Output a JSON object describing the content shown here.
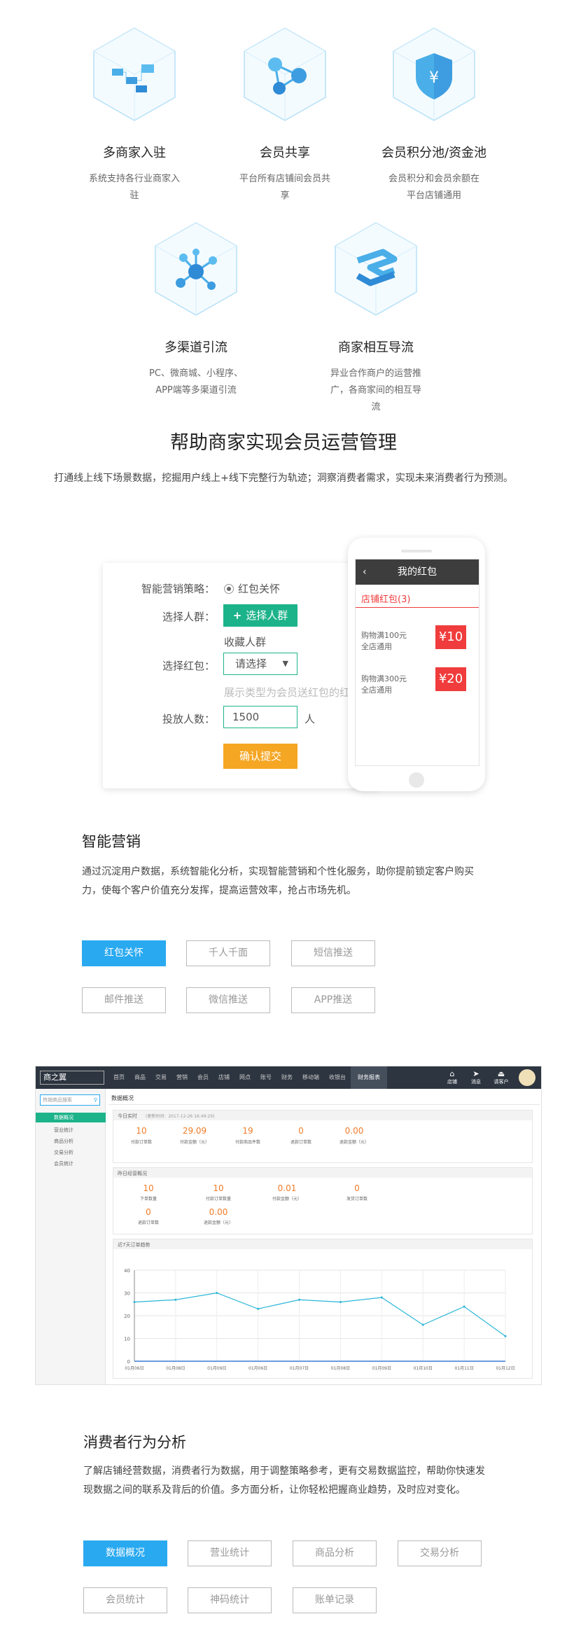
{
  "features": [
    {
      "title": "多商家入驻",
      "desc": "系统支持各行业商家入驻",
      "icon": "building-blocks-icon"
    },
    {
      "title": "会员共享",
      "desc": "平台所有店铺间会员共享",
      "icon": "network-nodes-icon"
    },
    {
      "title": "会员积分池/资金池",
      "desc": "会员积分和会员余额在平台店铺通用",
      "icon": "yuan-shield-icon"
    },
    {
      "title": "多渠道引流",
      "desc": "PC、微商城、小程序、APP端等多渠道引流",
      "icon": "hub-nodes-icon"
    },
    {
      "title": "商家相互导流",
      "desc": "异业合作商户的运营推广，各商家间的相互导流",
      "icon": "flow-arrows-icon"
    }
  ],
  "section": {
    "title": "帮助商家实现会员运营管理",
    "subtitle": "打通线上线下场景数据，挖掘用户线上+线下完整行为轨迹；洞察消费者需求，实现未来消费者行为预测。"
  },
  "form": {
    "strategy_label": "智能营销策略：",
    "strategy_value": "红包关怀",
    "crowd_label": "选择人群：",
    "crowd_button": "选择人群",
    "crowd_value": "收藏人群",
    "packet_label": "选择红包：",
    "packet_placeholder": "请选择",
    "packet_hint": "展示类型为会员送红包的红包",
    "count_label": "投放人数：",
    "count_value": "1500",
    "count_unit": "人",
    "submit": "确认提交"
  },
  "phone": {
    "title": "我的红包",
    "shop_packet": "店铺红包(3)",
    "coupons": [
      {
        "cond": "购物满100元",
        "scope": "全店通用",
        "amount": "¥10"
      },
      {
        "cond": "购物满300元",
        "scope": "全店通用",
        "amount": "¥20"
      }
    ]
  },
  "marketing": {
    "title": "智能营销",
    "desc": "通过沉淀用户数据，系统智能化分析，实现智能营销和个性化服务，助你提前锁定客户购买力，使每个客户价值充分发挥，提高运营效率，抢占市场先机。",
    "buttons": [
      "红包关怀",
      "千人千面",
      "短信推送",
      "邮件推送",
      "微信推送",
      "APP推送"
    ],
    "active_index": 0
  },
  "dashboard": {
    "logo": "商之翼",
    "nav": [
      "首页",
      "商品",
      "交易",
      "营销",
      "会员",
      "店铺",
      "网点",
      "账号",
      "财务",
      "移动端",
      "收银台",
      "财务报表"
    ],
    "nav_active": "财务报表",
    "right_icons": [
      {
        "label": "店铺",
        "icon": "home-icon"
      },
      {
        "label": "消息",
        "icon": "send-icon"
      },
      {
        "label": "请客户",
        "icon": "eject-icon"
      }
    ],
    "search_placeholder": "热销商品搜索",
    "sidebar": [
      "数据概况",
      "营业统计",
      "商品分析",
      "交易分析",
      "会员统计"
    ],
    "sidebar_active": "数据概况",
    "page_title": "数据概况",
    "today_label": "今日实时",
    "today_time": "(更新时间：2017-12-26 16:49:29)",
    "today_stats": [
      {
        "value": "10",
        "label": "付款订单数"
      },
      {
        "value": "29.09",
        "label": "付款金额（元）"
      },
      {
        "value": "19",
        "label": "付款商品件数"
      },
      {
        "value": "0",
        "label": "退款订单数"
      },
      {
        "value": "0.00",
        "label": "退款金额（元）"
      }
    ],
    "yesterday_label": "昨日经营概况",
    "yesterday_stats": [
      {
        "value": "10",
        "label": "下单数量"
      },
      {
        "value": "10",
        "label": "付款订单数量"
      },
      {
        "value": "0.01",
        "label": "付款金额（元）"
      },
      {
        "value": "0",
        "label": "发货订单数"
      },
      {
        "value": "0",
        "label": "退款订单数"
      },
      {
        "value": "0.00",
        "label": "退款金额（元）"
      }
    ],
    "trend_label": "近7天订单趋势"
  },
  "chart_data": {
    "type": "line",
    "categories": [
      "01月06日",
      "01月08日",
      "01月09日",
      "01月06日",
      "01月07日",
      "01月08日",
      "01月09日",
      "01月10日",
      "01月11日",
      "01月12日"
    ],
    "values": [
      26,
      27,
      30,
      23,
      27,
      26,
      28,
      16,
      24,
      11
    ],
    "ylim": [
      0,
      40
    ],
    "yticks": [
      0,
      10,
      20,
      30,
      40
    ],
    "grid": true,
    "color": "#29b6d8"
  },
  "analysis": {
    "title": "消费者行为分析",
    "desc": "了解店铺经营数据，消费者行为数据，用于调整策略参考，更有交易数据监控，帮助你快速发现数据之间的联系及背后的价值。多方面分析，让你轻松把握商业趋势，及时应对变化。",
    "buttons": [
      "数据概况",
      "营业统计",
      "商品分析",
      "交易分析",
      "会员统计",
      "神码统计",
      "账单记录"
    ],
    "active_index": 0
  },
  "colors": {
    "accent": "#29a9f0",
    "green": "#1db38a",
    "orange": "#f5a623",
    "red": "#f03c3c",
    "teal": "#29b6d8"
  }
}
